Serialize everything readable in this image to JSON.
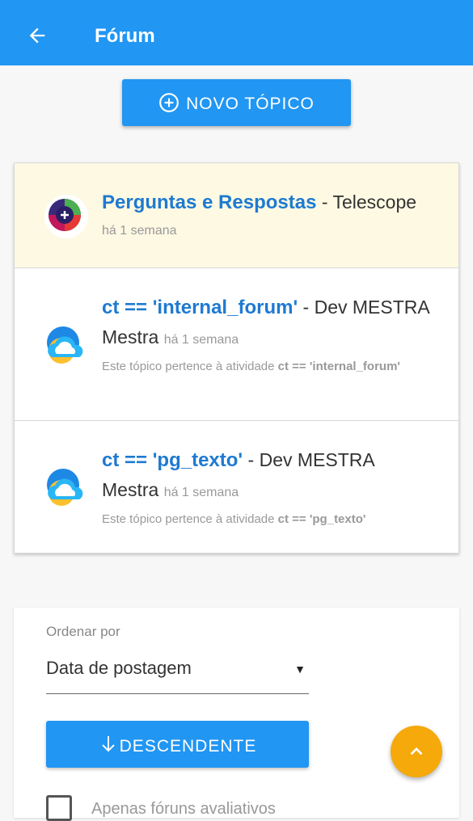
{
  "appbar": {
    "title": "Fórum",
    "back_icon": "arrow-left-icon"
  },
  "new_topic_button": {
    "label": "NOVO TÓPICO",
    "icon": "add-circle-icon"
  },
  "topics": [
    {
      "title": "Perguntas e Respostas",
      "author_sep": " - Telescope",
      "time": "há 1 semana",
      "avatar": "telescope-logo",
      "highlight": true
    },
    {
      "title": "ct == 'internal_forum'",
      "author_sep": " - Dev MESTRA Mestra ",
      "time": "há 1 semana",
      "desc_prefix": "Este tópico pertence à atividade ",
      "desc_bold": "ct == 'internal_forum'",
      "avatar": "cloud-logo"
    },
    {
      "title": "ct == 'pg_texto'",
      "author_sep": " - Dev MESTRA Mestra ",
      "time": "há 1 semana",
      "desc_prefix": "Este tópico pertence à atividade ",
      "desc_bold": "ct == 'pg_texto'",
      "avatar": "cloud-logo"
    }
  ],
  "sort": {
    "label": "Ordenar por",
    "selected": "Data de postagem",
    "direction_button": "DESCENDENTE",
    "direction_icon": "arrow-down-icon"
  },
  "filter": {
    "checkbox_label": "Apenas fóruns avaliativos",
    "checked": false
  },
  "fab": {
    "icon": "chevron-up-icon"
  },
  "colors": {
    "primary": "#2196f3",
    "link": "#1e7ad1",
    "accent": "#f5a90a",
    "highlight_bg": "#fdf9e3"
  }
}
